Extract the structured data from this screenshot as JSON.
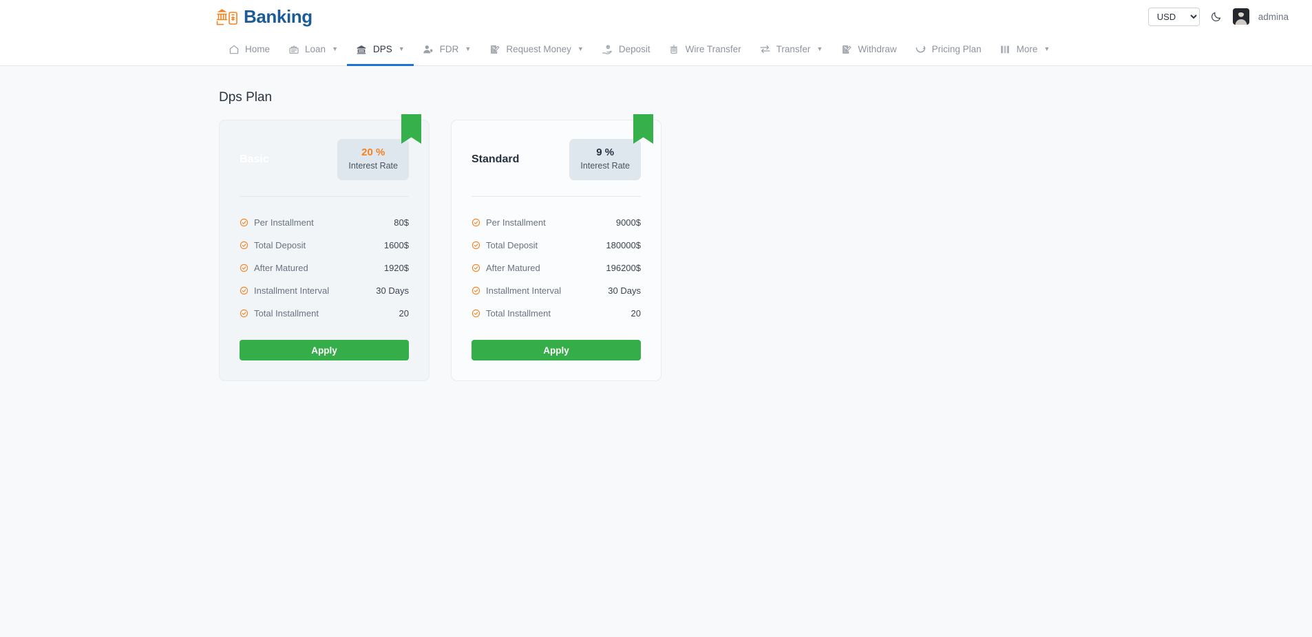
{
  "header": {
    "brand_name": "Banking",
    "logo_icon": "bank-mobile-icon",
    "currency": {
      "selected": "USD",
      "options": [
        "USD"
      ]
    },
    "theme_toggle_icon": "moon-icon",
    "avatar_icon": "user-avatar",
    "username": "admina"
  },
  "nav": {
    "items": [
      {
        "label": "Home",
        "icon": "home-icon",
        "caret": false,
        "active": false
      },
      {
        "label": "Loan",
        "icon": "loan-icon",
        "caret": true,
        "active": false
      },
      {
        "label": "DPS",
        "icon": "bank-icon",
        "caret": true,
        "active": true
      },
      {
        "label": "FDR",
        "icon": "user-shield-icon",
        "caret": true,
        "active": false
      },
      {
        "label": "Request Money",
        "icon": "request-money-icon",
        "caret": true,
        "active": false
      },
      {
        "label": "Deposit",
        "icon": "deposit-hand-icon",
        "caret": false,
        "active": false
      },
      {
        "label": "Wire Transfer",
        "icon": "wire-transfer-icon",
        "caret": false,
        "active": false
      },
      {
        "label": "Transfer",
        "icon": "exchange-arrows-icon",
        "caret": true,
        "active": false
      },
      {
        "label": "Withdraw",
        "icon": "withdraw-icon",
        "caret": false,
        "active": false
      },
      {
        "label": "Pricing Plan",
        "icon": "pricing-plan-icon",
        "caret": false,
        "active": false
      },
      {
        "label": "More",
        "icon": "more-columns-icon",
        "caret": true,
        "active": false
      }
    ]
  },
  "page": {
    "title": "Dps Plan"
  },
  "plans": [
    {
      "name": "Basic",
      "rate_value": "20 %",
      "rate_label": "Interest Rate",
      "ribbon_icon": "ribbon-badge",
      "specs": [
        {
          "label": "Per Installment",
          "value": "80$"
        },
        {
          "label": "Total Deposit",
          "value": "1600$"
        },
        {
          "label": "After Matured",
          "value": "1920$"
        },
        {
          "label": "Installment Interval",
          "value": "30 Days"
        },
        {
          "label": "Total Installment",
          "value": "20"
        }
      ],
      "apply_label": "Apply"
    },
    {
      "name": "Standard",
      "rate_value": "9 %",
      "rate_label": "Interest Rate",
      "ribbon_icon": "ribbon-badge",
      "specs": [
        {
          "label": "Per Installment",
          "value": "9000$"
        },
        {
          "label": "Total Deposit",
          "value": "180000$"
        },
        {
          "label": "After Matured",
          "value": "196200$"
        },
        {
          "label": "Installment Interval",
          "value": "30 Days"
        },
        {
          "label": "Total Installment",
          "value": "20"
        }
      ],
      "apply_label": "Apply"
    }
  ],
  "colors": {
    "brand_blue": "#1b5c96",
    "accent_orange": "#f58220",
    "apply_green": "#35ad49",
    "ribbon_green": "#35b04b",
    "active_tab_blue": "#1c72d4",
    "page_bg": "#f8f9fb"
  }
}
